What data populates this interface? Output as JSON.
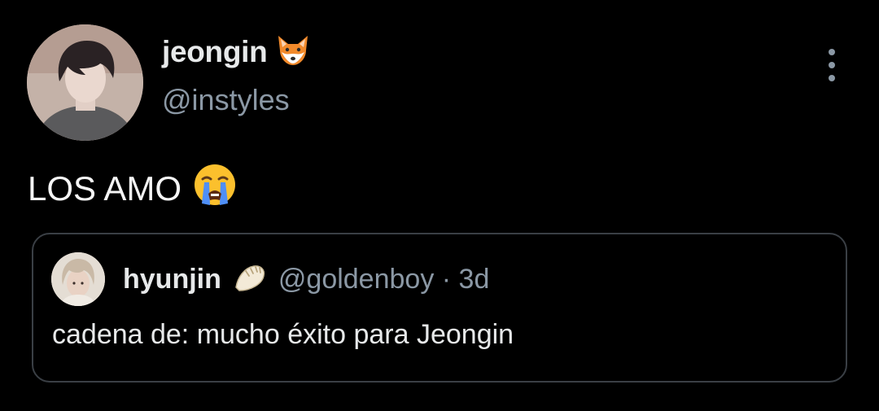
{
  "author": {
    "display_name": "jeongin",
    "name_emoji_icon": "fox-face-icon",
    "handle": "@instyles",
    "avatar_icon": "profile-photo"
  },
  "tweet": {
    "text": "LOS AMO",
    "emoji_icon": "loudly-crying-face-icon"
  },
  "quoted": {
    "display_name": "hyunjin",
    "name_emoji_icon": "dumpling-icon",
    "meta": "@goldenboy · 3d",
    "text": "cadena de: mucho éxito para Jeongin",
    "avatar_icon": "profile-photo"
  },
  "colors": {
    "background": "#000000",
    "primary_text": "#e7e9ea",
    "secondary_text": "#8b98a5",
    "card_border": "#3a3f45"
  }
}
